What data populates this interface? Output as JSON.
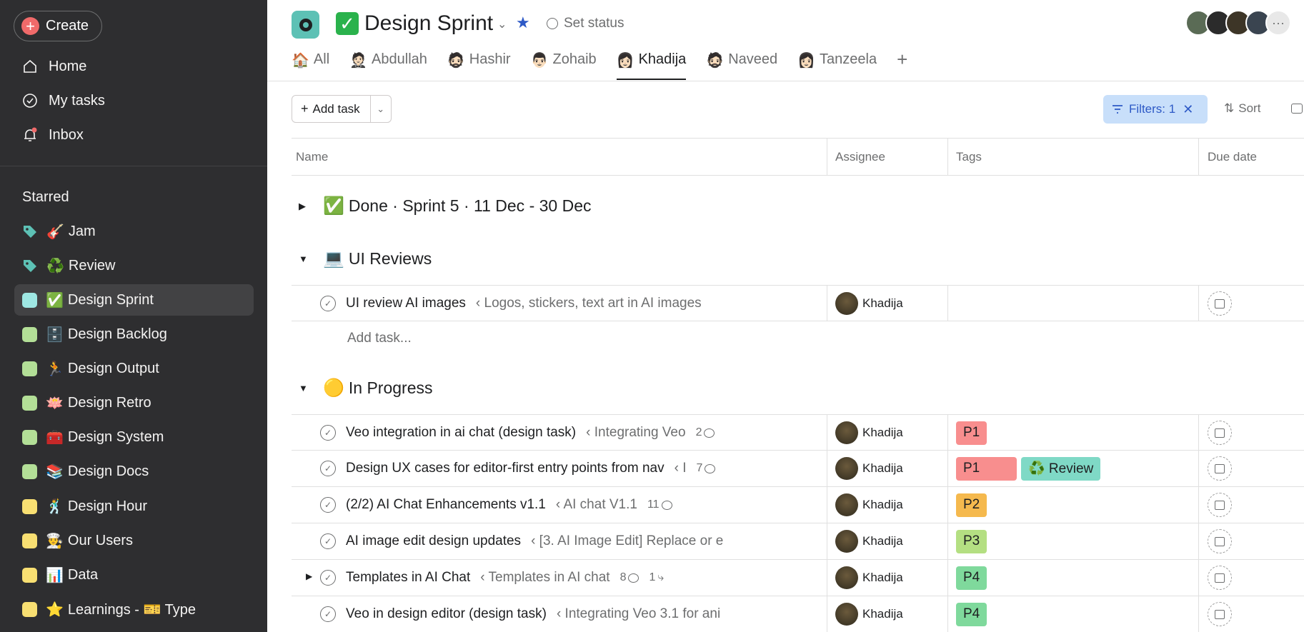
{
  "sidebar": {
    "create_label": "Create",
    "nav": [
      {
        "label": "Home",
        "icon": "home-icon"
      },
      {
        "label": "My tasks",
        "icon": "check-circle-icon"
      },
      {
        "label": "Inbox",
        "icon": "bell-icon"
      }
    ],
    "starred_heading": "Starred",
    "starred": [
      {
        "emoji": "🎸",
        "label": "Jam",
        "kind": "tag",
        "color": "#5dc1b5"
      },
      {
        "emoji": "♻️",
        "label": "Review",
        "kind": "tag",
        "color": "#5dc1b5"
      },
      {
        "emoji": "✅",
        "label": "Design Sprint",
        "kind": "project",
        "color": "#9ee7e3",
        "active": true
      },
      {
        "emoji": "🗄️",
        "label": "Design Backlog",
        "kind": "project",
        "color": "#b3df97"
      },
      {
        "emoji": "🏃",
        "label": "Design Output",
        "kind": "project",
        "color": "#b3df97"
      },
      {
        "emoji": "🪷",
        "label": "Design Retro",
        "kind": "project",
        "color": "#b3df97"
      },
      {
        "emoji": "🧰",
        "label": "Design System",
        "kind": "project",
        "color": "#b3df97"
      },
      {
        "emoji": "📚",
        "label": "Design Docs",
        "kind": "project",
        "color": "#b3df97"
      },
      {
        "emoji": "🕺",
        "label": "Design Hour",
        "kind": "project",
        "color": "#f8df72"
      },
      {
        "emoji": "👨‍🍳",
        "label": "Our Users",
        "kind": "project",
        "color": "#f8df72"
      },
      {
        "emoji": "📊",
        "label": "Data",
        "kind": "project",
        "color": "#f8df72"
      },
      {
        "emoji": "⭐",
        "label": "Learnings - 🎫 Type",
        "kind": "project",
        "color": "#f8df72"
      }
    ]
  },
  "header": {
    "project_title": "Design Sprint",
    "set_status": "Set status",
    "tabs": [
      {
        "emoji": "🏠",
        "label": "All"
      },
      {
        "emoji": "🤵🏻",
        "label": "Abdullah"
      },
      {
        "emoji": "🧔🏻",
        "label": "Hashir"
      },
      {
        "emoji": "👨🏻",
        "label": "Zohaib"
      },
      {
        "emoji": "👩🏻",
        "label": "Khadija",
        "active": true
      },
      {
        "emoji": "🧔🏻",
        "label": "Naveed"
      },
      {
        "emoji": "👩🏻",
        "label": "Tanzeela"
      }
    ],
    "avatar_more": "···"
  },
  "toolbar": {
    "add_task": "Add task",
    "filters": "Filters: 1",
    "sort": "Sort"
  },
  "table": {
    "columns": {
      "name": "Name",
      "assignee": "Assignee",
      "tags": "Tags",
      "due": "Due date"
    },
    "sections": [
      {
        "emoji": "✅",
        "title": "Done · Sprint 5 · 11 Dec - 30 Dec",
        "collapsed": true
      },
      {
        "emoji": "💻",
        "title": "UI Reviews"
      },
      {
        "emoji": "🟡",
        "title": "In Progress"
      }
    ],
    "ui_review_rows": [
      {
        "name": "UI review AI images",
        "parent": "‹ Logos, stickers, text art in AI images",
        "assignee": "Khadija",
        "tags": []
      }
    ],
    "add_task_placeholder": "Add task...",
    "in_progress_rows": [
      {
        "name": "Veo integration in ai chat (design task)",
        "parent": "‹ Integrating Veo",
        "comments": "2",
        "assignee": "Khadija",
        "tags": [
          {
            "label": "P1",
            "color": "#f88e8e"
          }
        ]
      },
      {
        "name": "Design UX cases for editor-first entry points from nav",
        "parent": "‹ I",
        "comments": "7",
        "assignee": "Khadija",
        "tags": [
          {
            "label": "P1",
            "color": "#f88e8e",
            "wide": true
          },
          {
            "label": "♻️ Review",
            "color": "#7fd9c6"
          }
        ]
      },
      {
        "name": "(2/2) AI Chat Enhancements v1.1",
        "parent": "‹ AI chat V1.1",
        "comments": "11",
        "assignee": "Khadija",
        "tags": [
          {
            "label": "P2",
            "color": "#f5b94e"
          }
        ]
      },
      {
        "name": "AI image edit design updates",
        "parent": "‹ [3. AI Image Edit] Replace or e",
        "assignee": "Khadija",
        "tags": [
          {
            "label": "P3",
            "color": "#b4df82"
          }
        ]
      },
      {
        "name": "Templates in AI Chat",
        "parent": "‹ Templates in AI chat",
        "comments": "8",
        "subtasks": "1",
        "assignee": "Khadija",
        "tags": [
          {
            "label": "P4",
            "color": "#7fd99c"
          }
        ],
        "expandable": true
      },
      {
        "name": "Veo in design editor (design task)",
        "parent": "‹ Integrating Veo 3.1 for ani",
        "assignee": "Khadija",
        "tags": [
          {
            "label": "P4",
            "color": "#7fd99c"
          }
        ]
      }
    ]
  }
}
